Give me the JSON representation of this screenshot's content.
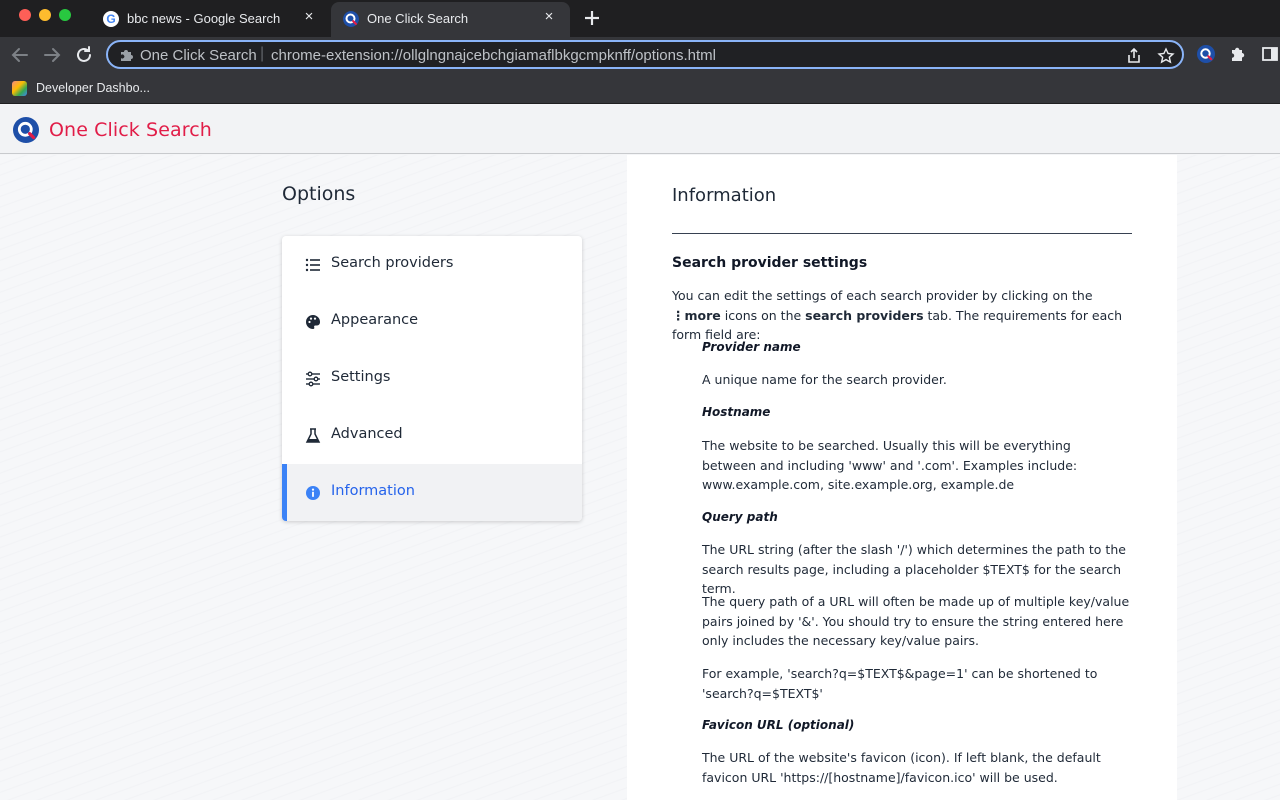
{
  "browser": {
    "tabs": [
      {
        "title": "bbc news - Google Search",
        "favicon": "google-icon",
        "active": false
      },
      {
        "title": "One Click Search",
        "favicon": "one-click-search-icon",
        "active": true
      }
    ],
    "new_tab_icon": "plus-icon",
    "close_icon": "×",
    "omnibox": {
      "site_label": "One Click Search",
      "separator": "|",
      "url": "chrome-extension://ollglngnajcebchgiamaflbkgcmpknff/options.html"
    },
    "bookmarks": [
      {
        "label": "Developer Dashbo..."
      }
    ],
    "colors": {
      "accent": "#8ab4f8",
      "traffic_red": "#fe5f57",
      "traffic_yellow": "#febc2e",
      "traffic_green": "#28c840"
    }
  },
  "header": {
    "brand": "One Click Search",
    "brand_color": "#e11d48"
  },
  "options": {
    "title": "Options",
    "menu": [
      {
        "label": "Search providers",
        "icon": "list-icon",
        "active": false
      },
      {
        "label": "Appearance",
        "icon": "palette-icon",
        "active": false
      },
      {
        "label": "Settings",
        "icon": "sliders-icon",
        "active": false
      },
      {
        "label": "Advanced",
        "icon": "flask-icon",
        "active": false
      },
      {
        "label": "Information",
        "icon": "info-icon",
        "active": true
      }
    ],
    "active_color": "#3b82f6"
  },
  "info": {
    "title": "Information",
    "section_title": "Search provider settings",
    "intro_before_more": "You can edit the settings of each search provider by clicking on the ",
    "more_glyph": "⋮",
    "more_label": "more",
    "intro_after_more": " icons on the ",
    "search_providers_label": "search providers",
    "intro_end": " tab. The requirements for each form field are:",
    "fields": [
      {
        "title": "Provider name",
        "paragraphs": [
          "A unique name for the search provider."
        ]
      },
      {
        "title": "Hostname",
        "paragraphs": [
          "The website to be searched. Usually this will be everything between and including 'www' and '.com'. Examples include: www.example.com, site.example.org, example.de"
        ]
      },
      {
        "title": "Query path",
        "paragraphs": [
          "The URL string (after the slash '/') which determines the path to the search results page, including a placeholder $TEXT$ for the search term.",
          "The query path of a URL will often be made up of multiple key/value pairs joined by '&'. You should try to ensure the string entered here only includes the necessary key/value pairs.",
          "For example, 'search?q=$TEXT$&page=1' can be shortened to 'search?q=$TEXT$'"
        ]
      },
      {
        "title": "Favicon URL (optional)",
        "paragraphs": [
          "The URL of the website's favicon (icon). If left blank, the default favicon URL 'https://[hostname]/favicon.ico' will be used."
        ]
      }
    ]
  }
}
